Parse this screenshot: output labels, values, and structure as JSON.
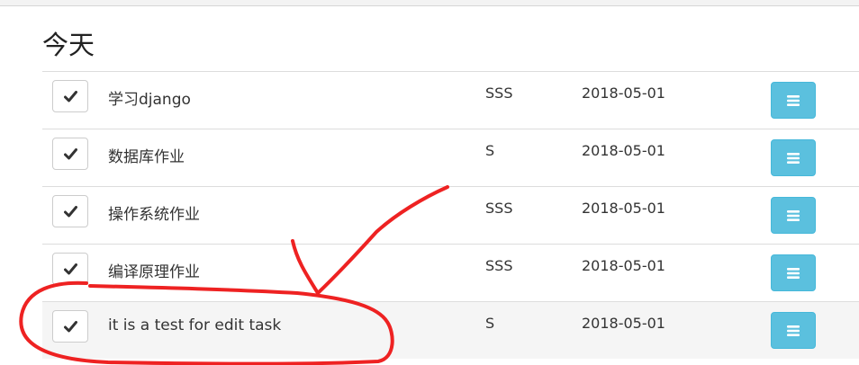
{
  "section": {
    "title": "今天"
  },
  "tasks": [
    {
      "name": "学习django",
      "priority": "SSS",
      "date": "2018-05-01"
    },
    {
      "name": "数据库作业",
      "priority": "S",
      "date": "2018-05-01"
    },
    {
      "name": "操作系统作业",
      "priority": "SSS",
      "date": "2018-05-01"
    },
    {
      "name": "编译原理作业",
      "priority": "SSS",
      "date": "2018-05-01"
    },
    {
      "name": "it is a test for edit task",
      "priority": "S",
      "date": "2018-05-01"
    }
  ],
  "icons": {
    "complete": "check-icon",
    "menu": "bars-icon"
  },
  "colors": {
    "menu_button": "#5bc0de",
    "annotation": "#ee2222",
    "highlight_row": "#f5f5f5"
  }
}
